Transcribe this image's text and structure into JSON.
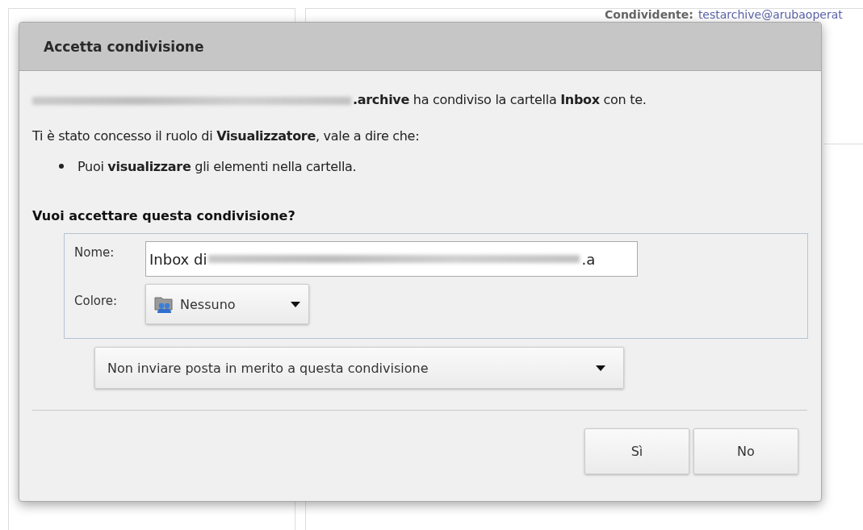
{
  "background": {
    "sharer_label": "Condividente:",
    "sharer_value": "testarchive@arubaoperat"
  },
  "dialog": {
    "title": "Accetta condivisione",
    "message": "**.archive** ha condiviso la cartella **Inbox** con te.",
    "role_text": "Ti è stato concesso il ruolo di **Visualizzatore**, vale a dire che:",
    "permissions": [
      "Puoi **visualizzare** gli elementi nella cartella."
    ],
    "question": "Vuoi accettare questa condivisione?",
    "name_label": "Nome:",
    "name_value_start": "Inbox di",
    "name_value_end": ".a",
    "color_label": "Colore:",
    "color_value": "Nessuno",
    "mail_option": "Non inviare posta in merito a questa condivisione",
    "buttons": [
      "Sì",
      "No"
    ]
  }
}
